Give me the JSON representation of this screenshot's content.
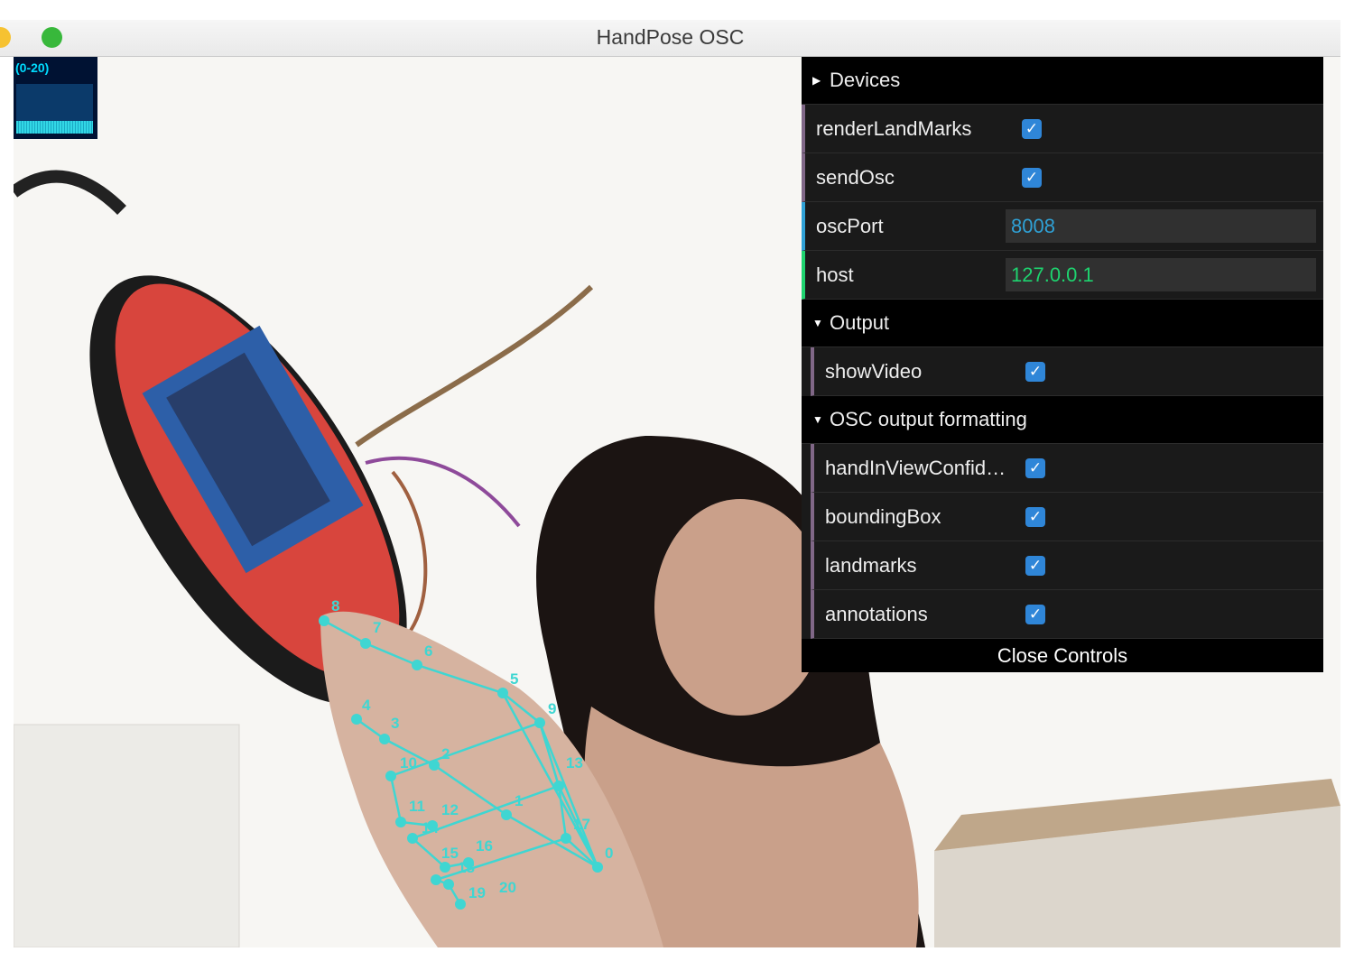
{
  "window": {
    "title": "HandPose OSC"
  },
  "stats_panel": {
    "label": "(0-20)"
  },
  "controls": {
    "devices_folder": {
      "label": "Devices",
      "expanded": false
    },
    "renderLandMarks": {
      "label": "renderLandMarks",
      "checked": true
    },
    "sendOsc": {
      "label": "sendOsc",
      "checked": true
    },
    "oscPort": {
      "label": "oscPort",
      "value": "8008"
    },
    "host": {
      "label": "host",
      "value": "127.0.0.1"
    },
    "output_folder": {
      "label": "Output",
      "expanded": true,
      "showVideo": {
        "label": "showVideo",
        "checked": true
      }
    },
    "osc_format_folder": {
      "label": "OSC output formatting",
      "expanded": true,
      "handInViewConfidence": {
        "label": "handInViewConfid…",
        "checked": true
      },
      "boundingBox": {
        "label": "boundingBox",
        "checked": true
      },
      "landmarks": {
        "label": "landmarks",
        "checked": true
      },
      "annotations": {
        "label": "annotations",
        "checked": true
      }
    },
    "close_label": "Close Controls"
  },
  "hand_landmarks": {
    "labels": [
      "0",
      "1",
      "2",
      "3",
      "4",
      "5",
      "6",
      "7",
      "8",
      "9",
      "10",
      "11",
      "12",
      "13",
      "14",
      "15",
      "16",
      "17",
      "18",
      "19",
      "20"
    ]
  },
  "colors": {
    "landmark": "#3fd6d2",
    "gui_background": "#1a1a1a",
    "number_accent": "#2fa1d6",
    "string_accent": "#1ed36f",
    "boolean_accent": "#806787",
    "checkbox": "#2f86d8"
  },
  "icons": {
    "folder_collapsed": "triangle-right-icon",
    "folder_expanded": "triangle-down-icon",
    "checkbox_checked": "checkmark-icon"
  }
}
